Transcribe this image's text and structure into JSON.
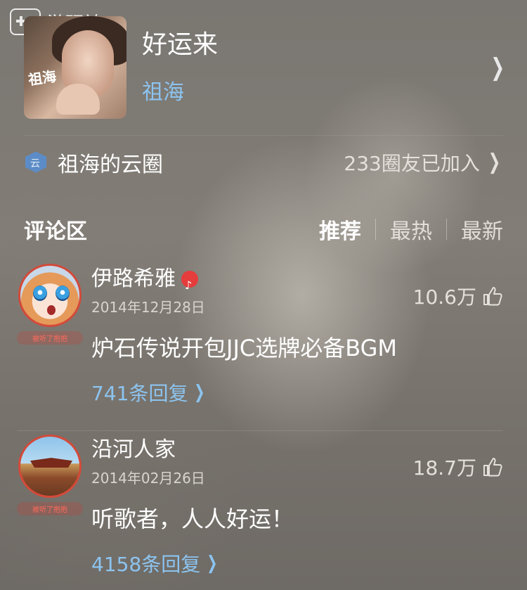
{
  "watermark": {
    "text": "游研社"
  },
  "song": {
    "title": "好运来",
    "artist": "祖海",
    "cover_text": "祖海"
  },
  "circle": {
    "name": "祖海的云圈",
    "count_label": "233圈友已加入"
  },
  "comments_section": {
    "title": "评论区",
    "tabs": [
      {
        "label": "推荐",
        "active": true
      },
      {
        "label": "最热",
        "active": false
      },
      {
        "label": "最新",
        "active": false
      }
    ]
  },
  "comments": [
    {
      "user": "伊路希雅",
      "date": "2014年12月28日",
      "text": "炉石传说开包JJC选牌必备BGM",
      "replies": "741条回复",
      "likes": "10.6万",
      "badge": "被听了抱抱"
    },
    {
      "user": "沿河人家",
      "date": "2014年02月26日",
      "text": "听歌者，人人好运！",
      "replies": "4158条回复",
      "likes": "18.7万",
      "badge": "被听了抱抱"
    }
  ]
}
